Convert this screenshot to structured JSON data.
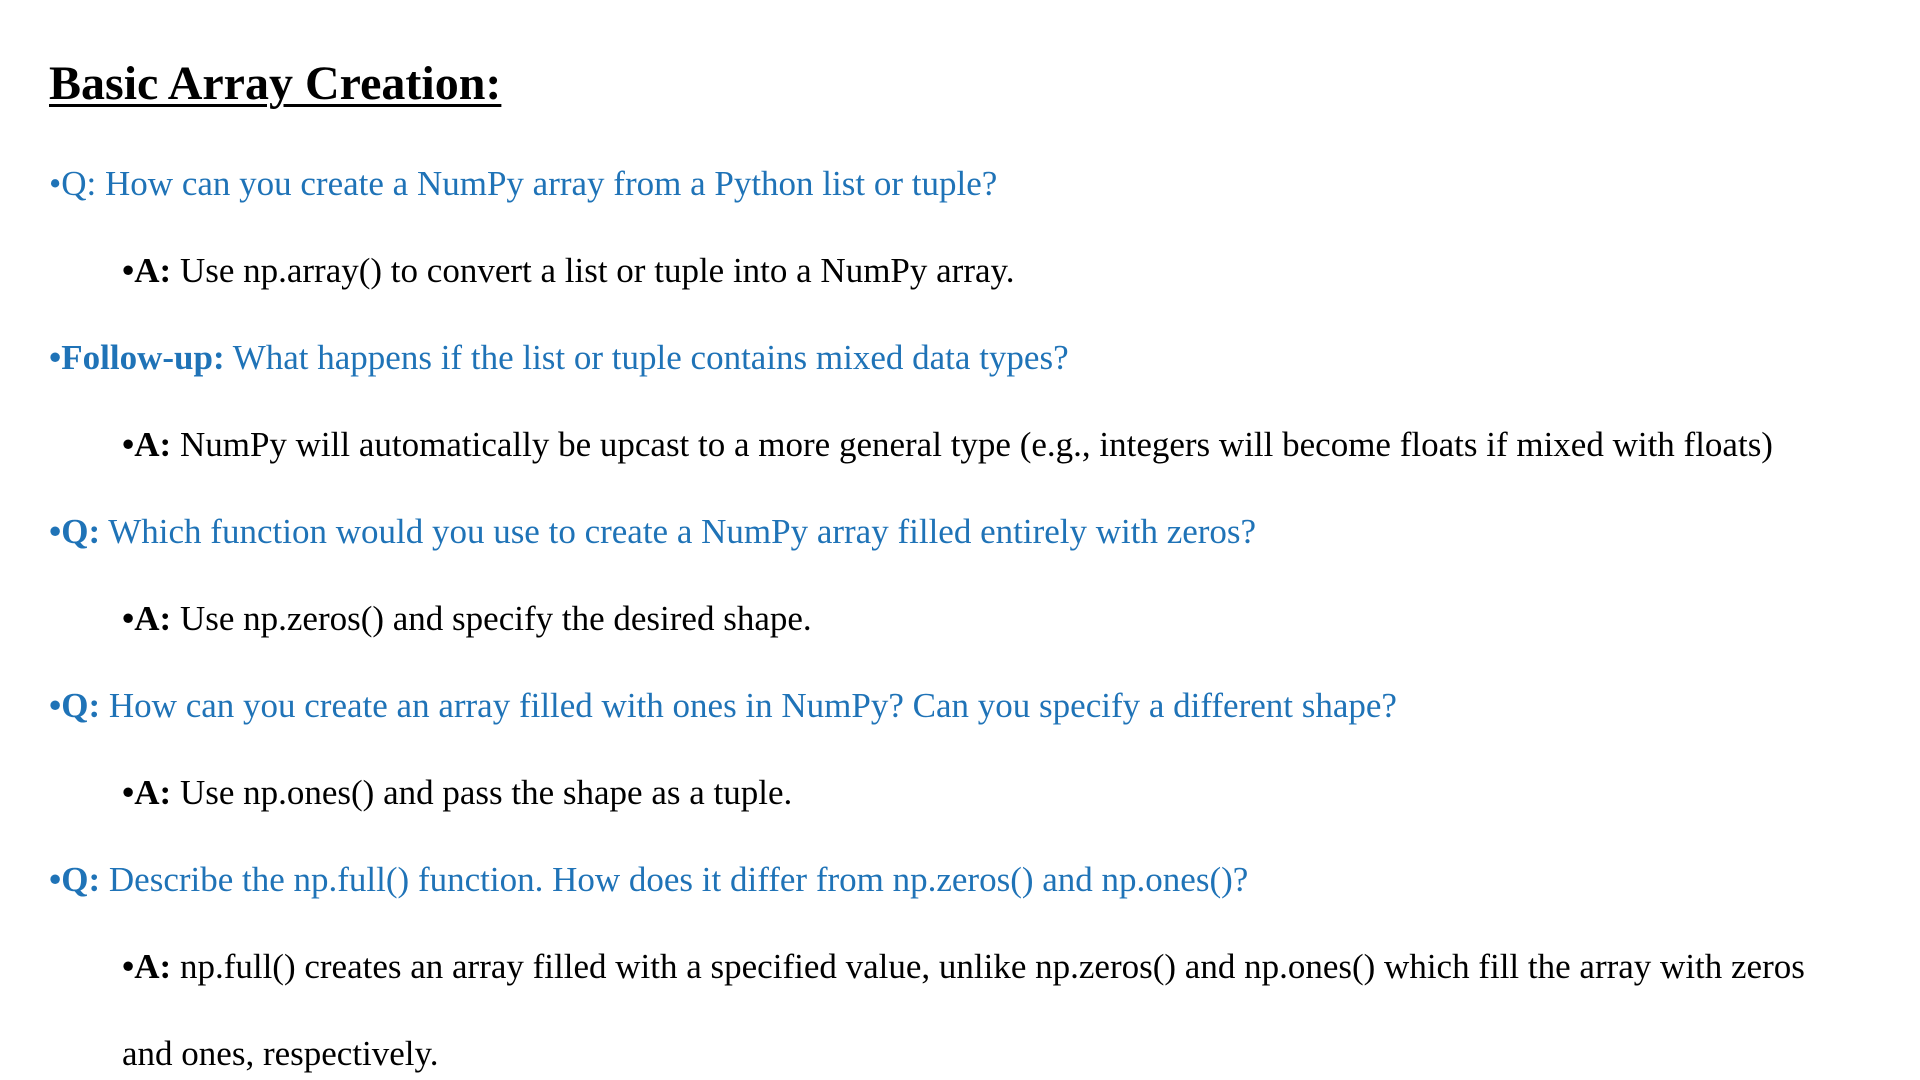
{
  "heading": "Basic Array Creation:",
  "items": [
    {
      "kind": "question",
      "lead": "•Q:",
      "text": " How can you create a NumPy array from a Python list or tuple?"
    },
    {
      "kind": "answer",
      "lead": "•A:",
      "text": " Use np.array() to convert a list or tuple into a NumPy array."
    },
    {
      "kind": "question",
      "lead": "•Follow-up:",
      "text": " What happens if the list or tuple contains mixed data types?"
    },
    {
      "kind": "answer",
      "lead": "•A:",
      "text": " NumPy will automatically be upcast to a more general type (e.g., integers will become floats if mixed with floats)"
    },
    {
      "kind": "question",
      "lead": "•Q:",
      "text": " Which function would you use to create a NumPy array filled entirely with zeros?"
    },
    {
      "kind": "answer",
      "lead": "•A:",
      "text": " Use np.zeros() and specify the desired shape."
    },
    {
      "kind": "question",
      "lead": "•Q:",
      "text": " How can you create an array filled with ones in NumPy? Can you specify a different shape?"
    },
    {
      "kind": "answer",
      "lead": "•A:",
      "text": " Use np.ones() and pass the shape as a tuple."
    },
    {
      "kind": "question",
      "lead": "•Q:",
      "text": " Describe the np.full() function. How does it differ from np.zeros() and np.ones()?"
    },
    {
      "kind": "answer",
      "lead": "•A:",
      "text": " np.full() creates an array filled with a specified value, unlike np.zeros() and np.ones() which fill the array with zeros"
    },
    {
      "kind": "continuation",
      "text": "and ones, respectively."
    }
  ]
}
